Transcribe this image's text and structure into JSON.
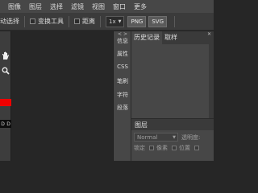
{
  "menu": [
    "图像",
    "图层",
    "选择",
    "滤镜",
    "视图",
    "窗口",
    "更多"
  ],
  "options": {
    "auto_select_label": "动选择",
    "transform_label": "变换工具",
    "distance_label": "距离",
    "zoom_value": "1x",
    "png_label": "PNG",
    "svg_label": "SVG"
  },
  "side_panel": {
    "arrows": "< >",
    "items": [
      "信息",
      "属性",
      "CSS",
      "笔刷",
      "字符",
      "段落"
    ]
  },
  "history_panel": {
    "tabs": [
      "历史记录",
      "取样"
    ],
    "close_glyph": "✕"
  },
  "layers_panel": {
    "tab": "图层",
    "blend_mode": "Normal",
    "opacity_label": "透明度:",
    "lock_label": "锁定",
    "pixel_label": "像素",
    "position_label": "位置"
  },
  "tools": {
    "swatch_labels": [
      "D",
      "D"
    ],
    "foreground_color": "#f00000"
  },
  "colors": {
    "menubar": "#474747",
    "optbar": "#3b3b3b",
    "panel": "#474747",
    "canvas": "#262626"
  }
}
